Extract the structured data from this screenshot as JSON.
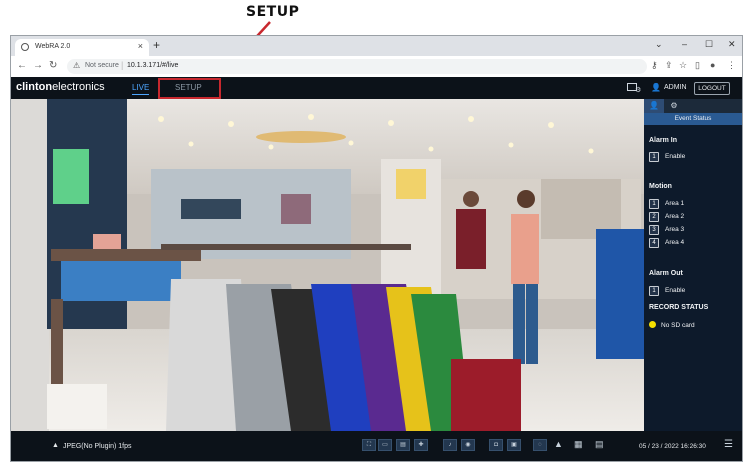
{
  "annotation": {
    "label": "SETUP",
    "box_color": "#c8282e"
  },
  "browser": {
    "tab_title": "WebRA 2.0",
    "close_glyph": "×",
    "new_tab_glyph": "+",
    "window_controls": [
      "⌄",
      "–",
      "☐",
      "✕"
    ],
    "security_text": "Not secure",
    "url": "10.1.3.171/#/live",
    "right_icons": [
      "key-icon",
      "share-icon",
      "star-icon",
      "sidebar-icon",
      "profile-icon",
      "kebab-menu-icon"
    ]
  },
  "app": {
    "logo_bold": "clinton",
    "logo_rest": "electronics",
    "tabs": {
      "live": "LIVE",
      "setup": "SETUP"
    },
    "user": "ADMIN",
    "logout": "LOGOUT",
    "accent_color": "#4da6ff"
  },
  "panel": {
    "event_title": "Event Status",
    "alarm_in": {
      "title": "Alarm In",
      "items": [
        {
          "n": "1",
          "label": "Enable"
        }
      ]
    },
    "motion": {
      "title": "Motion",
      "items": [
        {
          "n": "1",
          "label": "Area 1"
        },
        {
          "n": "2",
          "label": "Area 2"
        },
        {
          "n": "3",
          "label": "Area 3"
        },
        {
          "n": "4",
          "label": "Area 4"
        }
      ]
    },
    "alarm_out": {
      "title": "Alarm Out",
      "items": [
        {
          "n": "1",
          "label": "Enable"
        }
      ]
    },
    "record_status": {
      "title": "RECORD STATUS",
      "item": "No SD card",
      "indicator_color": "#f5e000"
    }
  },
  "bottom": {
    "stream": "JPEG(No Plugin) 1fps",
    "datetime": "05 / 23 / 2022  16:26:30"
  }
}
